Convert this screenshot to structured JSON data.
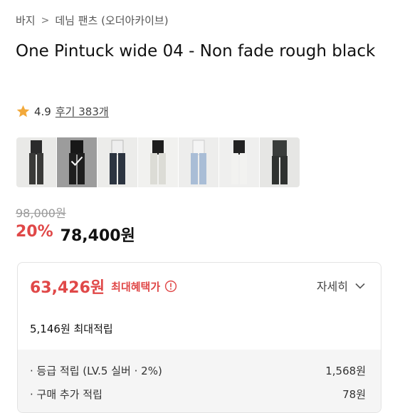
{
  "breadcrumb": {
    "category": "바지",
    "subcategory": "데님 팬츠 (오더아카이브)"
  },
  "product": {
    "title": "One Pintuck wide 04 - Non fade rough black"
  },
  "rating": {
    "score": "4.9",
    "reviews": "후기 383개"
  },
  "thumbnails": [
    {
      "label": "thumb-1",
      "selected": false
    },
    {
      "label": "thumb-2",
      "selected": true
    },
    {
      "label": "thumb-3",
      "selected": false
    },
    {
      "label": "thumb-4",
      "selected": false
    },
    {
      "label": "thumb-5",
      "selected": false
    },
    {
      "label": "thumb-6",
      "selected": false
    },
    {
      "label": "thumb-7",
      "selected": false
    }
  ],
  "price": {
    "original": "98,000원",
    "discount": "20%",
    "sale": "78,400원"
  },
  "benefit": {
    "max_price": "63,426원",
    "max_label": "최대혜택가",
    "detail_label": "자세히",
    "points_summary": "5,146원 최대적립",
    "rows": [
      {
        "label": "· 등급 적립 (LV.5 실버 · 2%)",
        "value": "1,568원"
      },
      {
        "label": "· 구매 추가 적립",
        "value": "78원"
      }
    ]
  },
  "colors": {
    "accent": "#e04848",
    "star": "#f2a93b"
  }
}
